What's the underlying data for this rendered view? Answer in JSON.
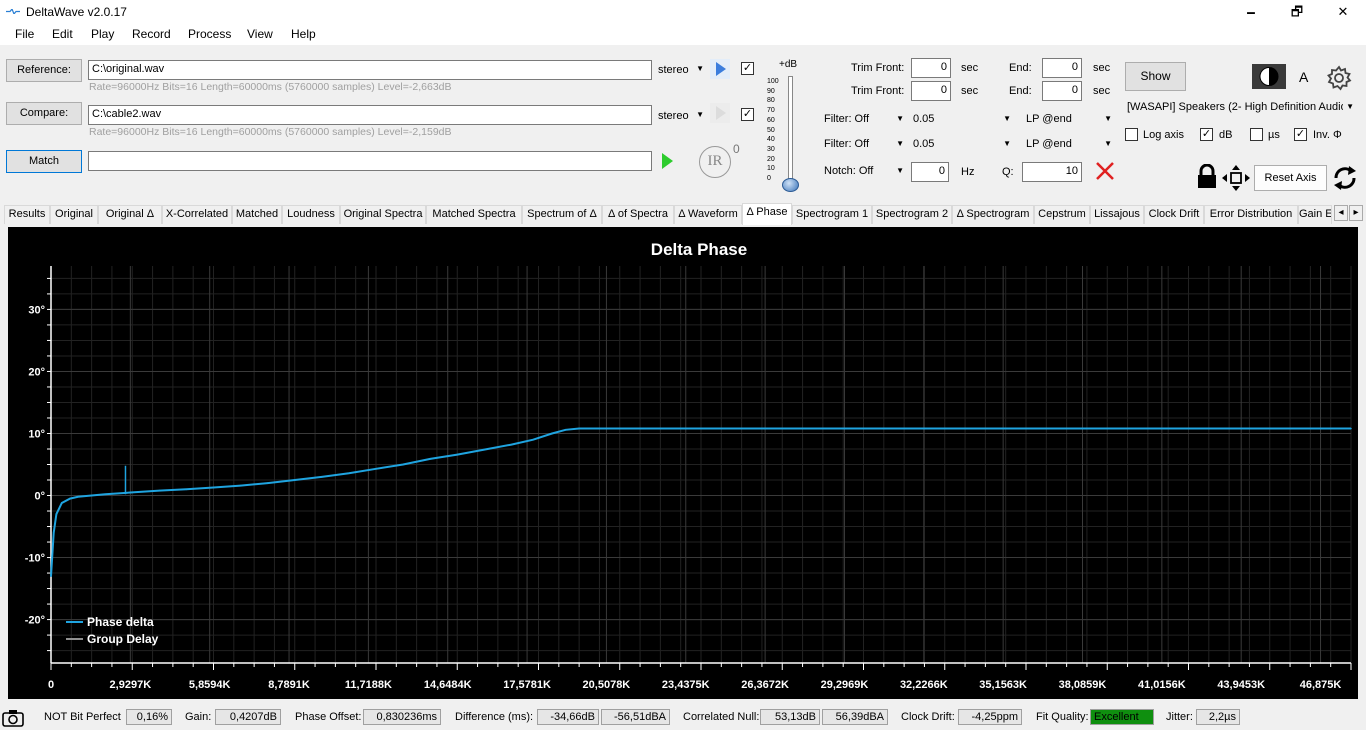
{
  "window": {
    "title": "DeltaWave v2.0.17",
    "controls": {
      "minimize": "🗕",
      "maximize": "🗗",
      "close": "✕"
    }
  },
  "menu": [
    "File",
    "Edit",
    "Play",
    "Record",
    "Process",
    "View",
    "Help"
  ],
  "files": {
    "reference_button": "Reference:",
    "reference_path": "C:\\original.wav",
    "reference_info": "Rate=96000Hz Bits=16 Length=60000ms (5760000 samples) Level=-2,663dB",
    "reference_mode": "stereo",
    "compare_button": "Compare:",
    "compare_path": "C:\\cable2.wav",
    "compare_info": "Rate=96000Hz Bits=16 Length=60000ms (5760000 samples) Level=-2,159dB",
    "compare_mode": "stereo",
    "match_button": "Match",
    "match_value": "",
    "ir_label": "IR",
    "ir_sup": "0",
    "check_mark": "✓"
  },
  "level_slider": {
    "title": "+dB",
    "ticks": [
      "100",
      "90",
      "80",
      "70",
      "60",
      "50",
      "40",
      "30",
      "20",
      "10",
      "0"
    ],
    "level_fraction": 0.0
  },
  "trim": {
    "front_label": "Trim Front:",
    "front1": "0",
    "front2": "0",
    "sec": "sec",
    "end_label": "End:",
    "end1": "0",
    "end2": "0"
  },
  "filters": {
    "filter1": "Filter: Off",
    "filter1_value": "0.05",
    "filter1_mode": "LP @end",
    "filter2": "Filter: Off",
    "filter2_value": "0.05",
    "filter2_mode": "LP @end",
    "notch": "Notch: Off",
    "notch_hz": "0",
    "hz": "Hz",
    "q_label": "Q:",
    "q_value": "10"
  },
  "output": {
    "show_button": "Show",
    "a_label": "A",
    "device": "[WASAPI] Speakers (2- High Definition Audio",
    "log_axis_label": "Log axis",
    "log_axis": false,
    "db_label": "dB",
    "db": true,
    "us_label": "µs",
    "us": false,
    "inv_label": "Inv. Φ",
    "inv": true,
    "reset_axis": "Reset Axis"
  },
  "tabs": [
    "Results",
    "Original",
    "Original Δ",
    "X-Correlated",
    "Matched",
    "Loudness",
    "Original Spectra",
    "Matched Spectra",
    "Spectrum of Δ",
    "Δ of Spectra",
    "Δ Waveform",
    "Δ Phase",
    "Spectrogram 1",
    "Spectrogram 2",
    "Δ Spectrogram",
    "Cepstrum",
    "Lissajous",
    "Clock Drift",
    "Error Distribution",
    "Gain E"
  ],
  "active_tab": "Δ Phase",
  "tab_scroll": {
    "left": "◂",
    "right": "▸"
  },
  "chart_data": {
    "type": "line",
    "title": "Delta Phase",
    "xlabel": "",
    "ylabel": "",
    "x_unit": "Hz",
    "xlim": [
      0,
      48000
    ],
    "ylim": [
      -27,
      37
    ],
    "yticks": [
      -20,
      -10,
      0,
      10,
      20,
      30
    ],
    "ytick_labels": [
      "-20°",
      "-10°",
      "0°",
      "10°",
      "20°",
      "30°"
    ],
    "xticks": [
      0,
      2929.7,
      5859.4,
      8789.1,
      11718.8,
      14648.4,
      17578.1,
      20507.8,
      23437.5,
      26367.2,
      29296.9,
      32226.6,
      35156.3,
      38085.9,
      41015.6,
      43945.3,
      46875
    ],
    "xtick_labels": [
      "0",
      "2,9297K",
      "5,8594K",
      "8,7891K",
      "11,7188K",
      "14,6484K",
      "17,5781K",
      "20,5078K",
      "23,4375K",
      "26,3672K",
      "29,2969K",
      "32,2266K",
      "35,1563K",
      "38,0859K",
      "41,0156K",
      "43,9453K",
      "46,875K"
    ],
    "grid": true,
    "legend_position": "bottom-left",
    "colors": {
      "background": "#000000",
      "grid": "#3a3a3a",
      "axis": "#ffffff"
    },
    "series": [
      {
        "name": "Phase delta",
        "color": "#1fa4e0",
        "x": [
          0,
          100,
          200,
          400,
          700,
          1000,
          1500,
          2000,
          3000,
          4000,
          5000,
          6000,
          7000,
          8000,
          9000,
          10000,
          11000,
          12000,
          13000,
          14000,
          15000,
          16000,
          17000,
          17800,
          18500,
          19000,
          19500,
          20000,
          30000,
          40000,
          48000
        ],
        "y": [
          -13,
          -6,
          -3,
          -1.2,
          -0.5,
          -0.2,
          0.0,
          0.2,
          0.5,
          0.8,
          1.0,
          1.3,
          1.6,
          2.0,
          2.5,
          3.0,
          3.6,
          4.3,
          5.0,
          5.9,
          6.6,
          7.4,
          8.2,
          9.0,
          10.0,
          10.6,
          10.8,
          10.8,
          10.8,
          10.8,
          10.8
        ]
      },
      {
        "name": "Group Delay",
        "color": "#909090",
        "x": [],
        "y": []
      }
    ],
    "annotations": [
      {
        "type": "spike",
        "x": 2750,
        "y": 4.8
      }
    ]
  },
  "status": {
    "bit_perfect": "NOT Bit Perfect",
    "bit_perfect_value": "0,16%",
    "gain_label": "Gain:",
    "gain_value": "0,4207dB",
    "phase_offset_label": "Phase Offset:",
    "phase_offset_value": "0,830236ms",
    "difference_label": "Difference (ms):",
    "difference_db": "-34,66dB",
    "difference_dba": "-56,51dBA",
    "correlated_null_label": "Correlated Null:",
    "correlated_null_db": "53,13dB",
    "correlated_null_dba": "56,39dBA",
    "clock_drift_label": "Clock Drift:",
    "clock_drift_value": "-4,25ppm",
    "fit_quality_label": "Fit Quality:",
    "fit_quality_value": "Excellent",
    "fit_quality_color": "#0f8f0f",
    "jitter_label": "Jitter:",
    "jitter_value": "2,2µs"
  }
}
